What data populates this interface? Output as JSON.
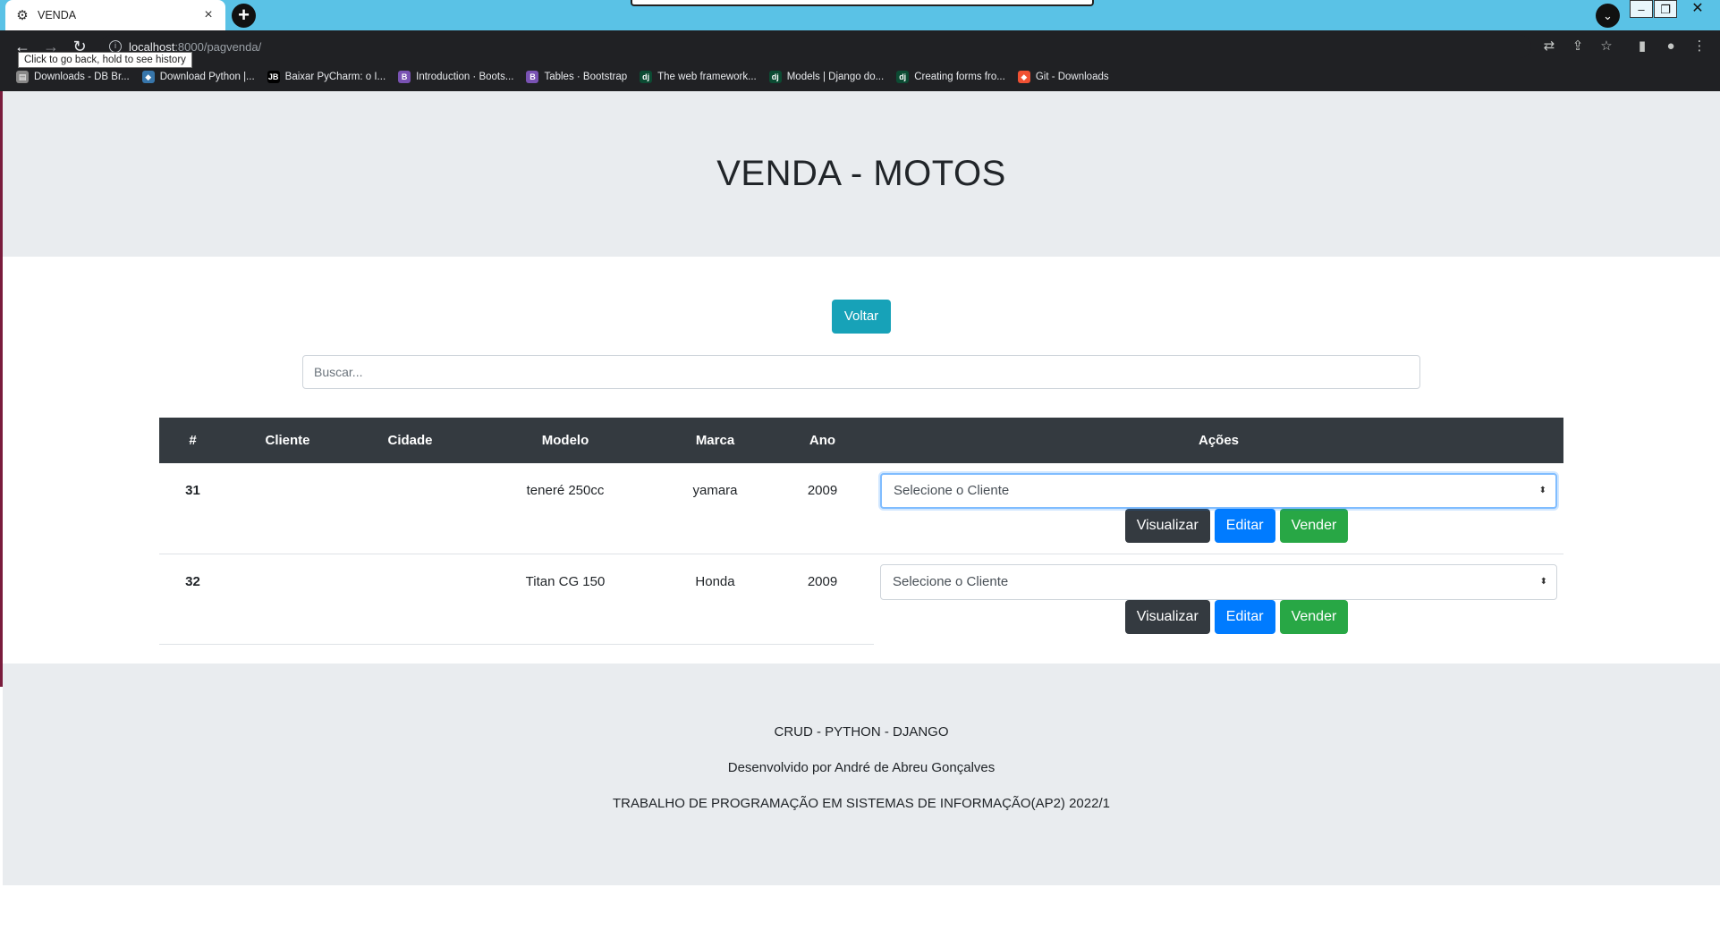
{
  "browser": {
    "tab_title": "VENDA",
    "tab_close": "×",
    "new_tab": "+",
    "url_host": "localhost",
    "url_path": ":8000/pagvenda/",
    "tooltip": "Click to go back, hold to see history",
    "bookmarks": [
      {
        "label": "Downloads - DB Br...",
        "icon": "db-icon",
        "color": "#888888",
        "glyph": "▤"
      },
      {
        "label": "Download Python |...",
        "icon": "python-icon",
        "color": "#3776ab",
        "glyph": "◆"
      },
      {
        "label": "Baixar PyCharm: o I...",
        "icon": "pycharm-icon",
        "color": "#000000",
        "glyph": "JB"
      },
      {
        "label": "Introduction · Boots...",
        "icon": "bootstrap-icon",
        "color": "#7952b3",
        "glyph": "B"
      },
      {
        "label": "Tables · Bootstrap",
        "icon": "bootstrap-icon",
        "color": "#7952b3",
        "glyph": "B"
      },
      {
        "label": "The web framework...",
        "icon": "django-icon",
        "color": "#0c4b33",
        "glyph": "dj"
      },
      {
        "label": "Models | Django do...",
        "icon": "django-icon",
        "color": "#0c4b33",
        "glyph": "dj"
      },
      {
        "label": "Creating forms fro...",
        "icon": "django-icon",
        "color": "#0c4b33",
        "glyph": "dj"
      },
      {
        "label": "Git - Downloads",
        "icon": "git-icon",
        "color": "#f05133",
        "glyph": "◆"
      }
    ]
  },
  "page": {
    "title": "VENDA - MOTOS",
    "back_button": "Voltar",
    "search_placeholder": "Buscar...",
    "table": {
      "headers": {
        "num": "#",
        "cliente": "Cliente",
        "cidade": "Cidade",
        "modelo": "Modelo",
        "marca": "Marca",
        "ano": "Ano",
        "acoes": "Ações"
      },
      "rows": [
        {
          "num": "31",
          "cliente": "",
          "cidade": "",
          "modelo": "teneré 250cc",
          "marca": "yamara",
          "ano": "2009",
          "select": "Selecione o Cliente"
        },
        {
          "num": "32",
          "cliente": "",
          "cidade": "",
          "modelo": "Titan CG 150",
          "marca": "Honda",
          "ano": "2009",
          "select": "Selecione o Cliente"
        }
      ],
      "action_labels": {
        "view": "Visualizar",
        "edit": "Editar",
        "sell": "Vender"
      }
    },
    "footer": {
      "line1": "CRUD - PYTHON - DJANGO",
      "line2": "Desenvolvido por André de Abreu Gonçalves",
      "line3": "TRABALHO DE PROGRAMAÇÃO EM SISTEMAS DE INFORMAÇÃO(AP2) 2022/1"
    }
  }
}
